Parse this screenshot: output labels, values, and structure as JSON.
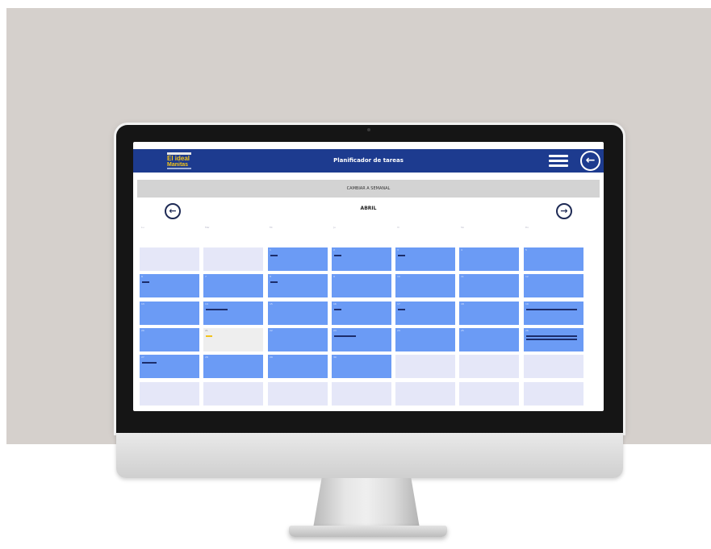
{
  "app": {
    "title": "Planificador de tareas",
    "logo_line1": "El ideal",
    "logo_line2": "Manitas",
    "menu_icon": "hamburger-menu-icon",
    "back_icon": "circle-arrow-left-icon"
  },
  "toolbar": {
    "toggle_label": "CAMBIAR A SEMANAL"
  },
  "calendar": {
    "month": "ABRIL",
    "prev_icon": "arrow-left-circle-icon",
    "next_icon": "arrow-right-circle-icon",
    "weekdays": [
      "Lu",
      "Mar",
      "Mi",
      "Ju",
      "Vi",
      "Sá",
      "Do"
    ],
    "colors": {
      "in_month": "#6b9bf5",
      "out_month": "#e5e7f8",
      "today": "#eeeeee",
      "task": "#1c2d6b",
      "highlight": "#f2c21a",
      "header": "#1d3b8f"
    },
    "weeks": [
      [
        {
          "day": "",
          "state": "out",
          "tasks": []
        },
        {
          "day": "",
          "state": "out",
          "tasks": []
        },
        {
          "day": "1",
          "state": "in",
          "tasks": [
            1
          ]
        },
        {
          "day": "2",
          "state": "in",
          "tasks": [
            1
          ]
        },
        {
          "day": "3",
          "state": "in",
          "tasks": [
            1
          ]
        },
        {
          "day": "4",
          "state": "in",
          "tasks": []
        },
        {
          "day": "5",
          "state": "in",
          "tasks": []
        }
      ],
      [
        {
          "day": "6",
          "state": "in",
          "tasks": [
            1
          ]
        },
        {
          "day": "7",
          "state": "in",
          "tasks": []
        },
        {
          "day": "8",
          "state": "in",
          "tasks": [
            1
          ]
        },
        {
          "day": "9",
          "state": "in",
          "tasks": []
        },
        {
          "day": "10",
          "state": "in",
          "tasks": []
        },
        {
          "day": "11",
          "state": "in",
          "tasks": []
        },
        {
          "day": "12",
          "state": "in",
          "tasks": []
        }
      ],
      [
        {
          "day": "13",
          "state": "in",
          "tasks": []
        },
        {
          "day": "14",
          "state": "in",
          "tasks": [
            3
          ]
        },
        {
          "day": "15",
          "state": "in",
          "tasks": []
        },
        {
          "day": "16",
          "state": "in",
          "tasks": [
            1
          ]
        },
        {
          "day": "17",
          "state": "in",
          "tasks": [
            1
          ]
        },
        {
          "day": "18",
          "state": "in",
          "tasks": []
        },
        {
          "day": "19",
          "state": "in",
          "tasks": [
            7
          ]
        }
      ],
      [
        {
          "day": "20",
          "state": "in",
          "tasks": []
        },
        {
          "day": "21",
          "state": "today",
          "tasks": [],
          "highlight": true
        },
        {
          "day": "22",
          "state": "in",
          "tasks": []
        },
        {
          "day": "23",
          "state": "in",
          "tasks": [
            3
          ]
        },
        {
          "day": "24",
          "state": "in",
          "tasks": []
        },
        {
          "day": "25",
          "state": "in",
          "tasks": []
        },
        {
          "day": "26",
          "state": "in",
          "tasks": [
            7,
            7
          ]
        }
      ],
      [
        {
          "day": "27",
          "state": "in",
          "tasks": [
            2
          ]
        },
        {
          "day": "28",
          "state": "in",
          "tasks": []
        },
        {
          "day": "29",
          "state": "in",
          "tasks": []
        },
        {
          "day": "30",
          "state": "in",
          "tasks": []
        },
        {
          "day": "",
          "state": "out",
          "tasks": []
        },
        {
          "day": "",
          "state": "out",
          "tasks": []
        },
        {
          "day": "",
          "state": "out",
          "tasks": []
        }
      ],
      [
        {
          "day": "",
          "state": "out",
          "tasks": []
        },
        {
          "day": "",
          "state": "out",
          "tasks": []
        },
        {
          "day": "",
          "state": "out",
          "tasks": []
        },
        {
          "day": "",
          "state": "out",
          "tasks": []
        },
        {
          "day": "",
          "state": "out",
          "tasks": []
        },
        {
          "day": "",
          "state": "out",
          "tasks": []
        },
        {
          "day": "",
          "state": "out",
          "tasks": []
        }
      ]
    ]
  }
}
